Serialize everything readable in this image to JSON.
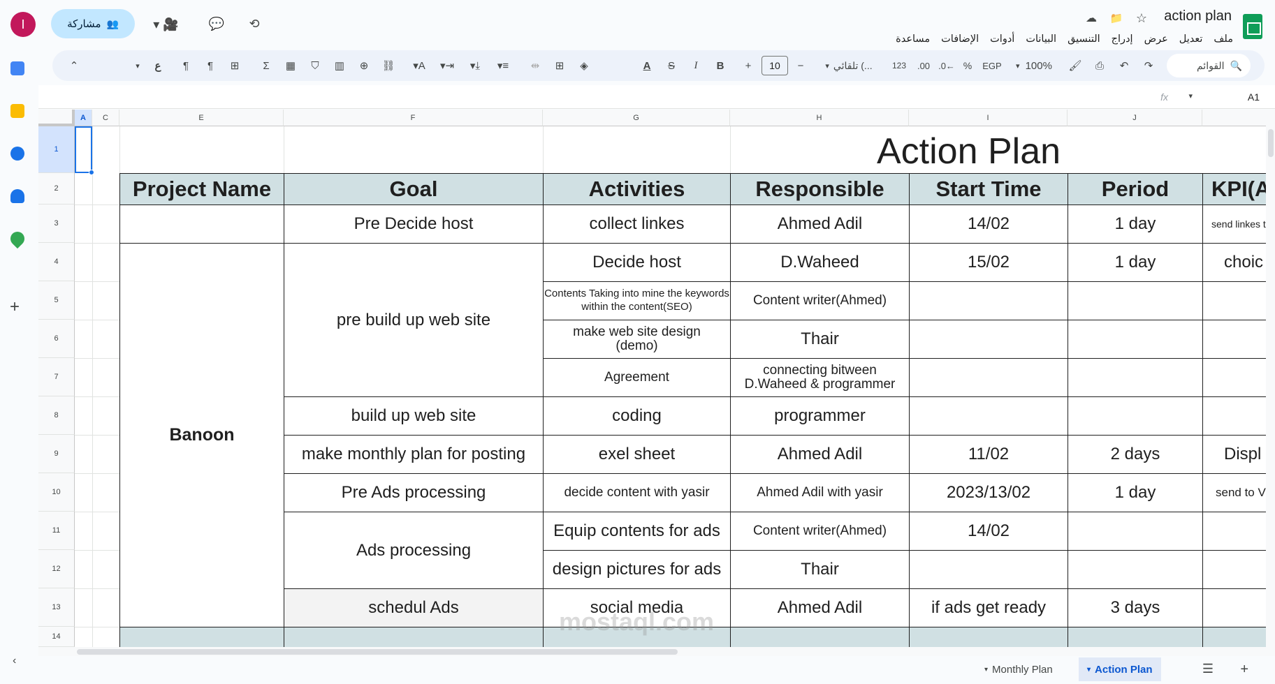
{
  "app": {
    "doc_title": "action plan",
    "share_label": "مشاركة",
    "avatar_letter": "I"
  },
  "menu": [
    "ملف",
    "تعديل",
    "عرض",
    "إدراج",
    "التنسيق",
    "البيانات",
    "أدوات",
    "الإضافات",
    "مساعدة"
  ],
  "toolbar": {
    "search_menus": "القوائم",
    "zoom": "100%",
    "currency": "EGP",
    "percent": "%",
    "decimal_decrease": ".0←",
    "decimal_increase": ".00",
    "number_format": "123",
    "font_name": "تلقائي (...",
    "font_size": "10",
    "minus": "−",
    "plus": "+",
    "bold": "B",
    "italic": "I",
    "strike": "S",
    "text_color": "A",
    "sigma": "Σ"
  },
  "formula_bar": {
    "name_box": "A1",
    "fx": "fx"
  },
  "columns": [
    "A",
    "C",
    "E",
    "F",
    "G",
    "H",
    "I",
    "J"
  ],
  "rows": [
    "1",
    "2",
    "3",
    "4",
    "5",
    "6",
    "7",
    "8",
    "9",
    "10",
    "11",
    "12",
    "13",
    "14"
  ],
  "sheet": {
    "title": "Action Plan",
    "headers": [
      "Project Name",
      "Goal",
      "Activities",
      "Responsible",
      "Start Time",
      "Period",
      "KPI(A"
    ],
    "project": "Banoon",
    "r3": {
      "goal": "Pre Decide host",
      "activity": "collect linkes",
      "responsible": "Ahmed Adil",
      "start": "14/02",
      "period": "1 day",
      "kpi": "send linkes t"
    },
    "r4": {
      "goal": "pre build up web site",
      "activity": "Decide host",
      "responsible": "D.Waheed",
      "start": "15/02",
      "period": "1 day",
      "kpi": "choic"
    },
    "r5": {
      "activity": "Contents Taking into mine the keywords within the content(SEO)",
      "responsible": "Content writer(Ahmed)"
    },
    "r6": {
      "activity": "make web site design (demo)",
      "responsible": "Thair"
    },
    "r7": {
      "activity": "Agreement",
      "responsible": "connecting bitween D.Waheed & programmer"
    },
    "r8": {
      "goal": "build up web site",
      "activity": "coding",
      "responsible": "programmer"
    },
    "r9": {
      "goal": "make monthly plan for posting",
      "activity": "exel sheet",
      "responsible": "Ahmed Adil",
      "start": "11/02",
      "period": "2 days",
      "kpi": "Displ"
    },
    "r10": {
      "goal": "Pre Ads processing",
      "activity": "decide content with yasir",
      "responsible": "Ahmed Adil with yasir",
      "start": "2023/13/02",
      "period": "1 day",
      "kpi": "send to V"
    },
    "r11": {
      "goal": "Ads processing",
      "activity": "Equip contents for ads",
      "responsible": "Content writer(Ahmed)",
      "start": "14/02"
    },
    "r12": {
      "activity": "design pictures for ads",
      "responsible": "Thair"
    },
    "r13": {
      "goal": "schedul Ads",
      "activity": "social media",
      "responsible": "Ahmed Adil",
      "start": "if ads get ready",
      "period": "3 days"
    }
  },
  "tabs": {
    "monthly": "Monthly Plan",
    "action": "Action Plan"
  },
  "watermark": "mostaql.com",
  "colors": {
    "header_fill": "#d0e0e3",
    "share_bg": "#c2e7ff",
    "avatar_bg": "#c2185b",
    "sheets_green": "#0f9d58",
    "active_tab": "#0b57d0"
  }
}
